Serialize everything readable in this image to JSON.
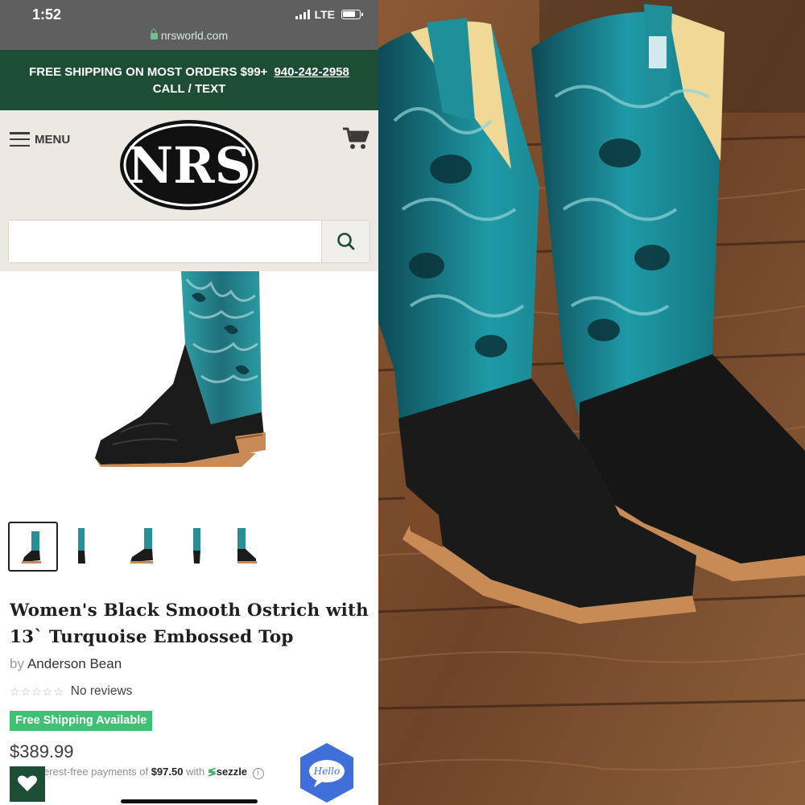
{
  "status_bar": {
    "time": "1:52",
    "network": "LTE",
    "url": "nrsworld.com"
  },
  "promo": {
    "text": "FREE SHIPPING ON MOST ORDERS $99+",
    "phone": "940-242-2958",
    "line2": "CALL / TEXT"
  },
  "header": {
    "menu_label": "MENU",
    "logo_text": "NRS"
  },
  "search": {
    "placeholder": ""
  },
  "product": {
    "title": "Women's Black Smooth Ostrich with 13` Turquoise Embossed Top",
    "brand_prefix": "by",
    "brand": "Anderson Bean",
    "rating_stars": "☆☆☆☆☆",
    "reviews": "No reviews",
    "shipping_badge": "Free Shipping Available",
    "price": "$389.99",
    "installment_prefix": "erest-free payments of",
    "installment_amount": "$97.50",
    "installment_with": "with",
    "installment_provider": "sezzle"
  },
  "thumbnails": {
    "count": 5,
    "active_index": 0
  },
  "chat": {
    "label": "Hello"
  },
  "colors": {
    "status_bar": "#5f5f5f",
    "promo_bg": "#1d4d33",
    "header_bg": "#ece9e3",
    "badge_green": "#3fc073",
    "chat_blue": "#3f6fd8",
    "boot_turquoise": "#1a8c96",
    "boot_black": "#1b1b1b",
    "floor_wood": "#7a4a2a"
  },
  "icons": [
    "lock-icon",
    "hamburger-icon",
    "cart-icon",
    "search-icon",
    "heart-icon",
    "chat-icon",
    "info-icon",
    "sezzle-icon"
  ]
}
